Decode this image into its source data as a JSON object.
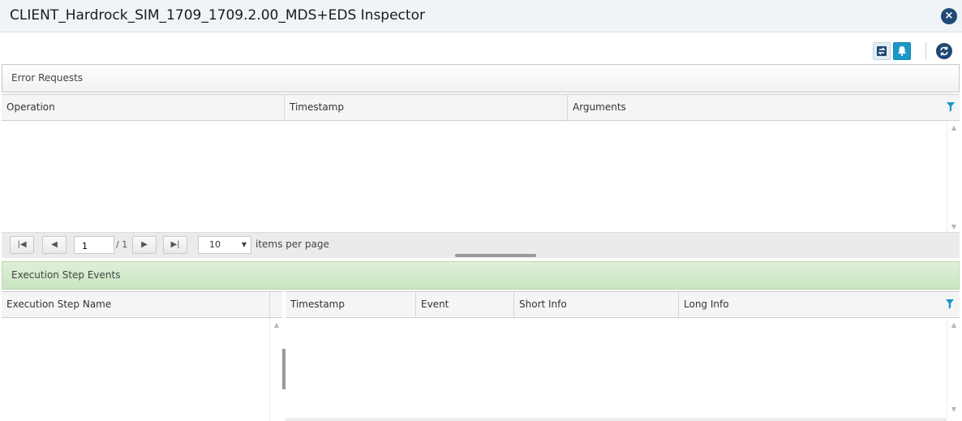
{
  "window": {
    "title": "CLIENT_Hardrock_SIM_1709_1709.2.00_MDS+EDS Inspector",
    "close_icon": "×"
  },
  "toolbar": {
    "icons": [
      "swap-icon",
      "bell-icon",
      "refresh-icon"
    ]
  },
  "error_requests": {
    "header": "Error Requests",
    "columns": [
      "Operation",
      "Timestamp",
      "Arguments"
    ],
    "pager": {
      "first": "|◀",
      "prev": "◀",
      "page_value": "1",
      "of_text": "/ 1",
      "next": "▶",
      "last": "▶|",
      "per_page_value": "10",
      "per_page_label": "items per page"
    }
  },
  "execution_step_events": {
    "header": "Execution Step Events",
    "left_column": "Execution Step Name",
    "columns": [
      "Timestamp",
      "Event",
      "Short Info",
      "Long Info"
    ]
  },
  "colors": {
    "title_bg": "#eef4f7",
    "accent": "#1998c8",
    "dark_icon": "#1f4a73",
    "green_header": "#dff0d8"
  }
}
